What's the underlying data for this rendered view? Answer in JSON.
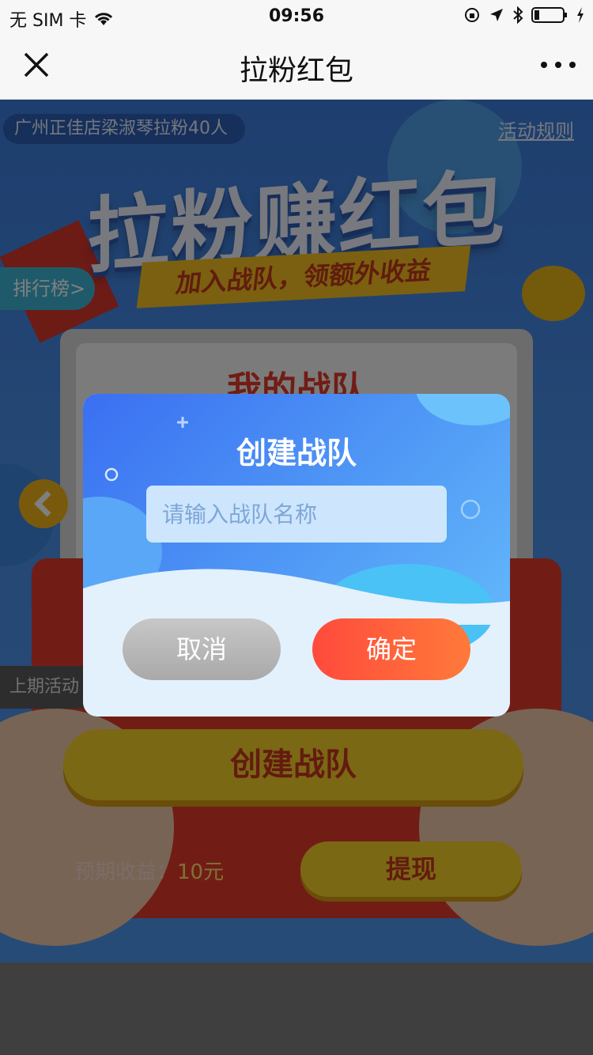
{
  "status_bar": {
    "carrier": "无 SIM 卡",
    "time": "09:56"
  },
  "nav": {
    "title": "拉粉红包"
  },
  "page": {
    "notice": "广州正佳店梁淑琴拉粉40人",
    "rules_link": "活动规则",
    "headline": "拉粉赚红包",
    "subheadline": "加入战队，领额外收益",
    "rank_link": "排行榜>",
    "team_card_title": "我的战队",
    "prev_activity": "上期活动",
    "create_team_button": "创建战队",
    "expected_label": "预期收益：",
    "expected_amount": "10元",
    "withdraw_button": "提现"
  },
  "dialog": {
    "title": "创建战队",
    "input_placeholder": "请输入战队名称",
    "input_value": "",
    "cancel_label": "取消",
    "confirm_label": "确定"
  },
  "colors": {
    "primary_blue": "#3a6ff2",
    "confirm_orange": "#ff5a3c",
    "button_yellow": "#f5d128"
  }
}
